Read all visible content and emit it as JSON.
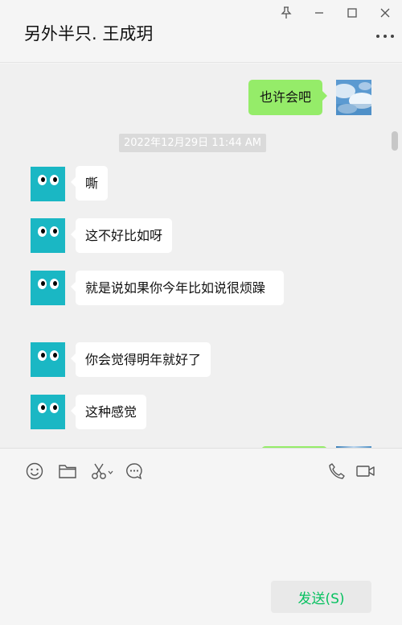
{
  "header": {
    "title": "另外半只. 王成玥"
  },
  "window_controls": {
    "icons": [
      "pin-icon",
      "minimize-icon",
      "maximize-icon",
      "close-icon"
    ]
  },
  "messages": {
    "self_1": "也许会吧",
    "timestamp": "2022年12月29日 11:44 AM",
    "other_1": "嘶",
    "other_2": "这不好比如呀",
    "other_3": "就是说如果你今年比如说很烦躁",
    "other_4": "你会觉得明年就好了",
    "other_5": "这种感觉"
  },
  "toolbar": {
    "icons": [
      "emoji-icon",
      "folder-icon",
      "scissors-icon",
      "chat-history-icon",
      "phone-icon",
      "video-call-icon"
    ]
  },
  "composer": {
    "send_label": "发送(S)"
  },
  "colors": {
    "self_bubble": "#95ec69",
    "other_bubble": "#ffffff",
    "avatar": "#1ab7c4",
    "send_text": "#07c160"
  }
}
